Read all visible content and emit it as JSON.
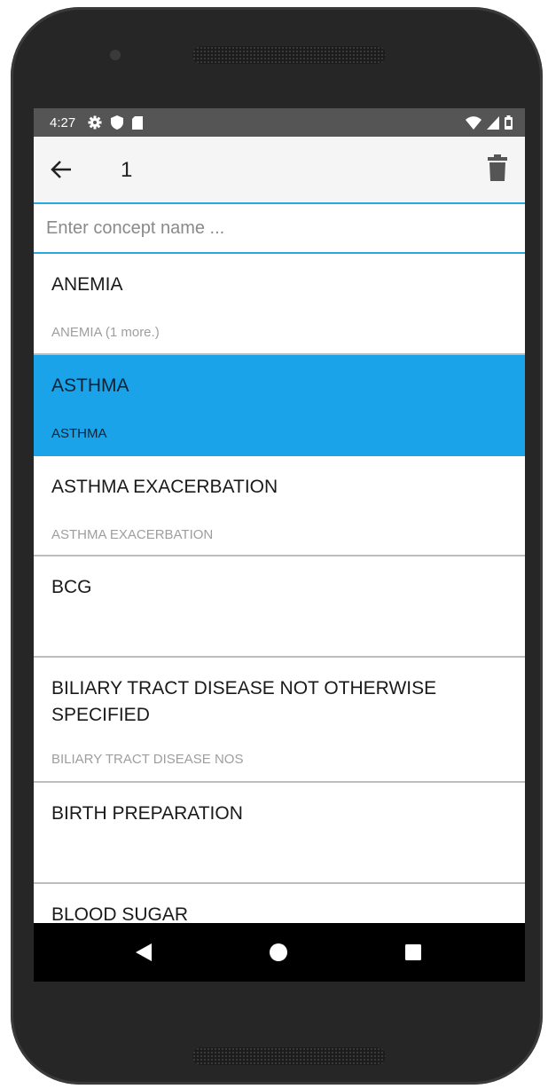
{
  "status_bar": {
    "time": "4:27",
    "left_icons": [
      "gear-icon",
      "shield-icon",
      "sd-card-icon"
    ],
    "right_icons": [
      "wifi-icon",
      "signal-icon",
      "battery-icon"
    ]
  },
  "app_bar": {
    "title": "1",
    "back_icon": "arrow-left-icon",
    "delete_icon": "trash-icon"
  },
  "search": {
    "placeholder": "Enter concept name ...",
    "value": ""
  },
  "colors": {
    "accent": "#29a8e0",
    "selected_row": "#1aa3e8",
    "status_bar": "#555555",
    "app_bar": "#f5f5f5"
  },
  "concepts": [
    {
      "title": "ANEMIA",
      "subtitle": "ANEMIA (1 more.)",
      "selected": false
    },
    {
      "title": "ASTHMA",
      "subtitle": "ASTHMA",
      "selected": true
    },
    {
      "title": "ASTHMA EXACERBATION",
      "subtitle": "ASTHMA EXACERBATION",
      "selected": false
    },
    {
      "title": "BCG",
      "subtitle": "",
      "selected": false
    },
    {
      "title": "BILIARY TRACT DISEASE NOT OTHERWISE SPECIFIED",
      "subtitle": "BILIARY TRACT DISEASE NOS",
      "selected": false
    },
    {
      "title": "BIRTH PREPARATION",
      "subtitle": "",
      "selected": false
    },
    {
      "title": "BLOOD SUGAR",
      "subtitle": "",
      "selected": false
    }
  ],
  "nav_bar": {
    "icons": [
      "back-triangle-icon",
      "home-circle-icon",
      "recents-square-icon"
    ]
  }
}
